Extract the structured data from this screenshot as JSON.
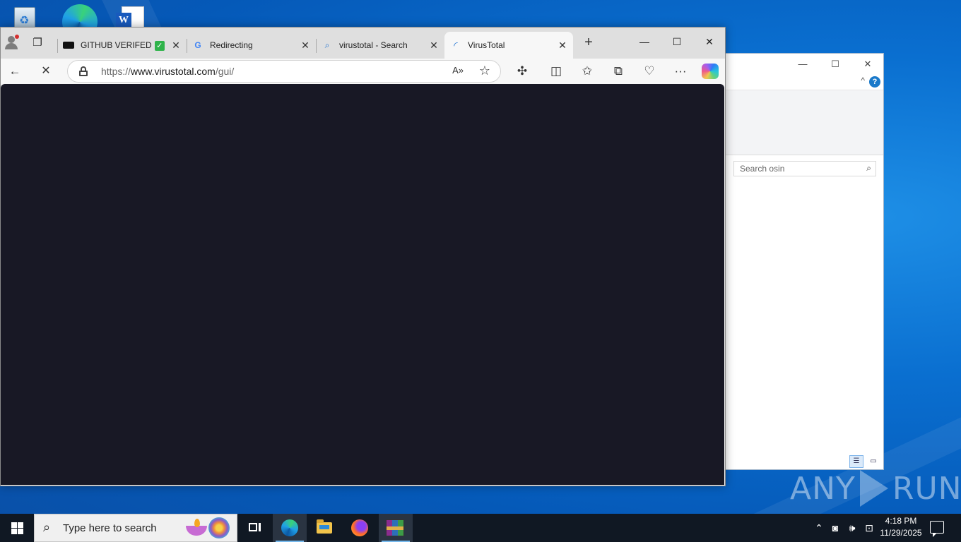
{
  "browser": {
    "tabs": [
      {
        "label": "GITHUB VERIFED",
        "badge": "✓",
        "close": "✕"
      },
      {
        "label": "Redirecting",
        "close": "✕"
      },
      {
        "label": "virustotal - Search",
        "close": "✕"
      },
      {
        "label": "VirusTotal",
        "close": "✕",
        "active": true
      }
    ],
    "new_tab": "+",
    "window_controls": {
      "minimize": "—",
      "maximize": "☐",
      "close": "✕"
    },
    "address": {
      "protocol": "https://",
      "host": "www.virustotal.com",
      "path": "/gui/"
    },
    "read_aloud": "A»",
    "favorite": "☆",
    "back": "←",
    "stop": "✕",
    "more": "···",
    "content_background": "#181825"
  },
  "explorer": {
    "search_placeholder": "Search osin",
    "window_controls": {
      "minimize": "—",
      "maximize": "☐",
      "close": "✕"
    },
    "help": "?",
    "collapse": "^"
  },
  "taskbar": {
    "search_placeholder": "Type here to search",
    "time": "4:18 PM",
    "date": "11/29/2025"
  },
  "watermark": {
    "left": "ANY",
    "right": "RUN"
  }
}
